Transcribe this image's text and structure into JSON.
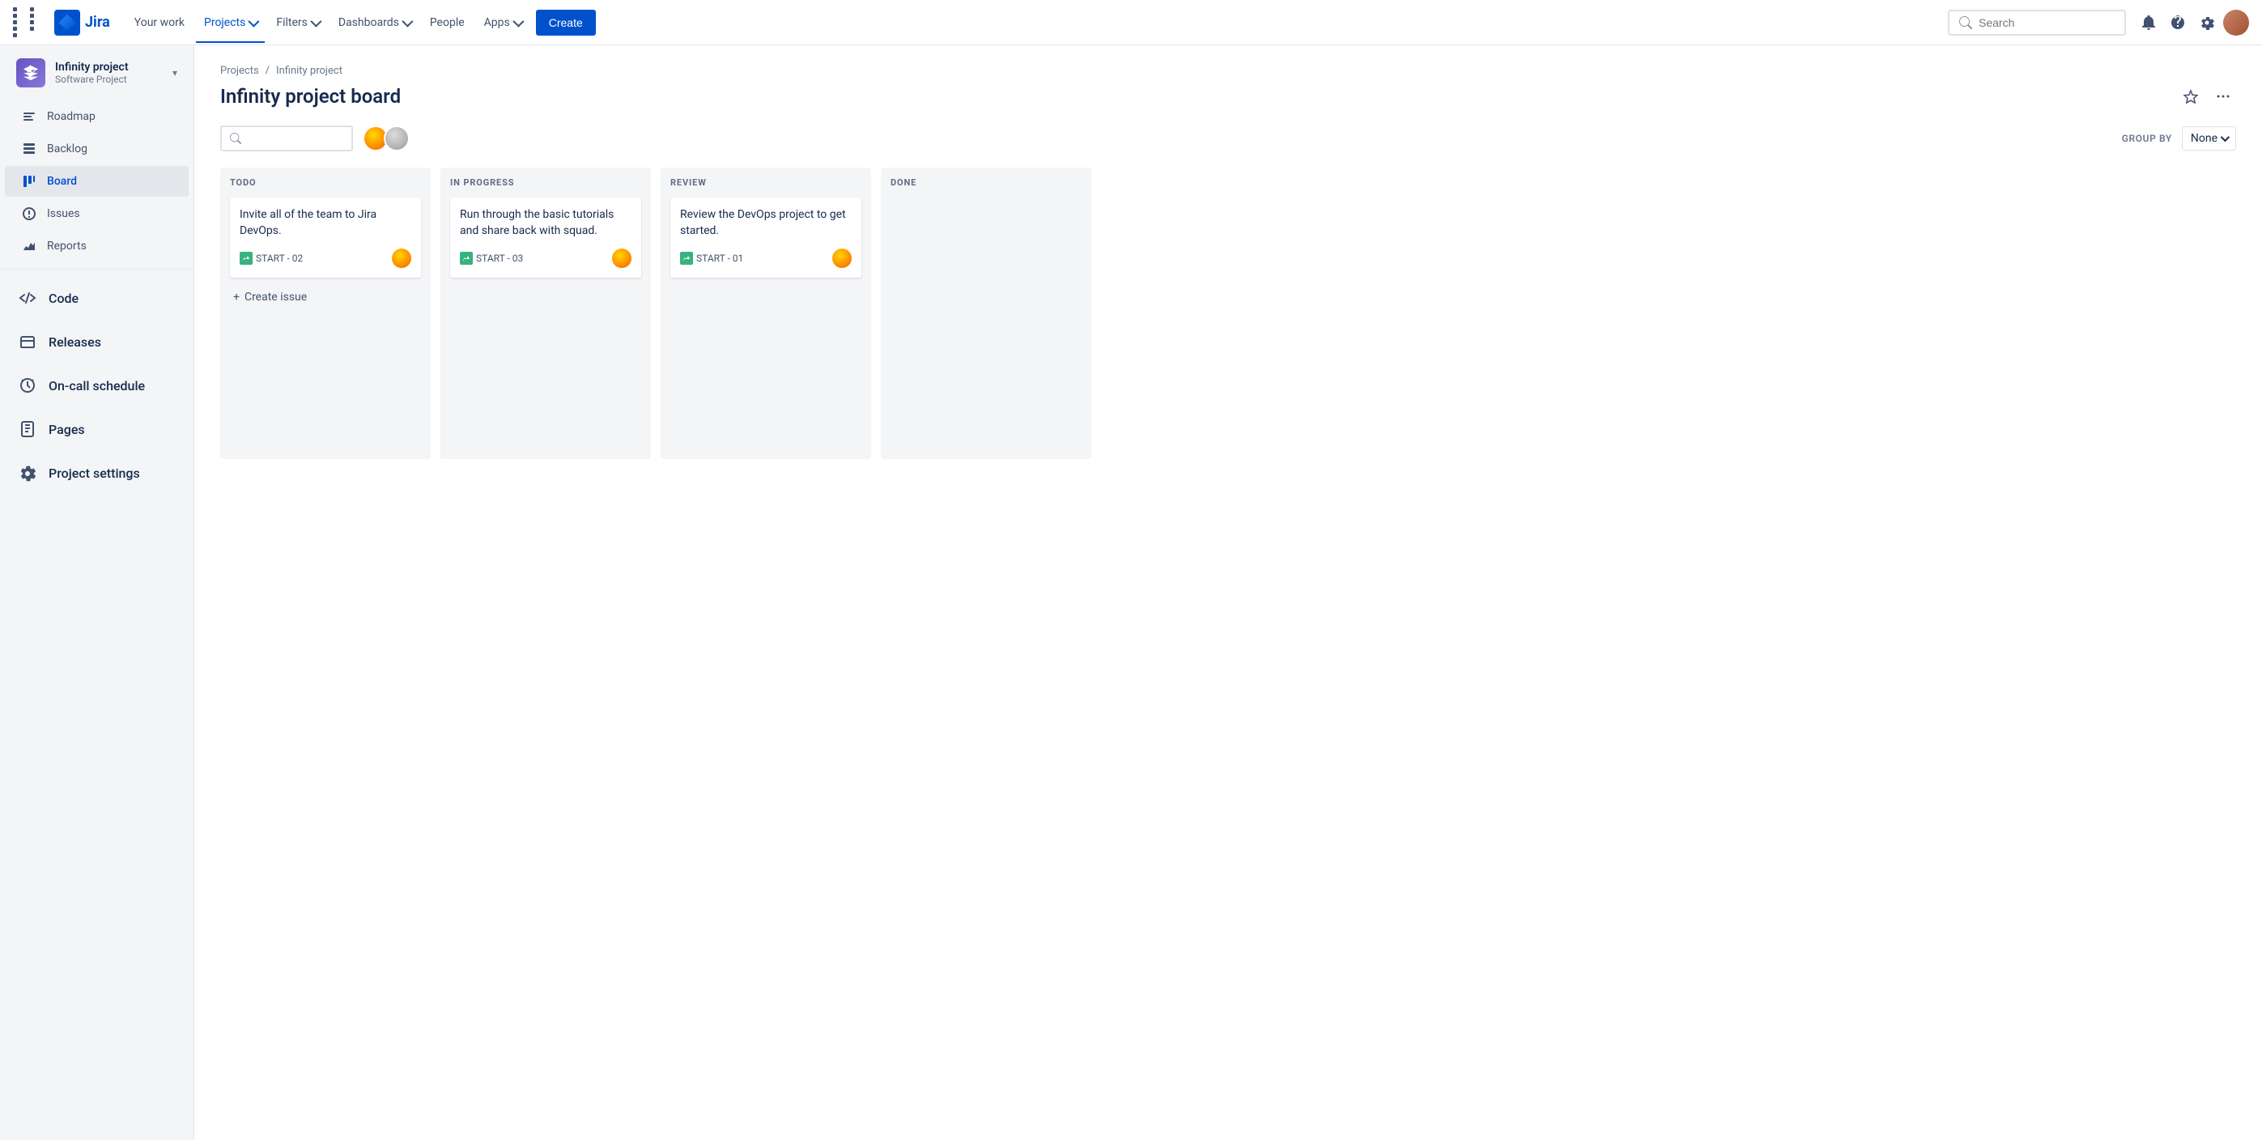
{
  "topnav": {
    "logo_text": "Jira",
    "links": [
      {
        "label": "Your work",
        "active": false
      },
      {
        "label": "Projects",
        "active": true,
        "has_dropdown": true
      },
      {
        "label": "Filters",
        "active": false,
        "has_dropdown": true
      },
      {
        "label": "Dashboards",
        "active": false,
        "has_dropdown": true
      },
      {
        "label": "People",
        "active": false
      },
      {
        "label": "Apps",
        "active": false,
        "has_dropdown": true
      }
    ],
    "create_label": "Create",
    "search_placeholder": "Search"
  },
  "sidebar": {
    "project_name": "Infinity project",
    "project_type": "Software Project",
    "nav_items": [
      {
        "label": "Roadmap",
        "icon": "roadmap"
      },
      {
        "label": "Backlog",
        "icon": "backlog"
      },
      {
        "label": "Board",
        "icon": "board",
        "active": true
      },
      {
        "label": "Issues",
        "icon": "issues"
      },
      {
        "label": "Reports",
        "icon": "reports"
      }
    ],
    "section_items": [
      {
        "label": "Code",
        "icon": "code"
      },
      {
        "label": "Releases",
        "icon": "releases"
      },
      {
        "label": "On-call schedule",
        "icon": "oncall"
      },
      {
        "label": "Pages",
        "icon": "pages"
      },
      {
        "label": "Project settings",
        "icon": "settings"
      }
    ]
  },
  "breadcrumb": {
    "items": [
      "Projects",
      "Infinity project"
    ]
  },
  "page": {
    "title": "Infinity project board"
  },
  "board_toolbar": {
    "search_placeholder": "",
    "group_by_label": "GROUP BY",
    "group_by_value": "None"
  },
  "columns": [
    {
      "id": "todo",
      "header": "TODO",
      "cards": [
        {
          "title": "Invite all of the team to Jira DevOps.",
          "tag": "START - 02",
          "avatar": "orange"
        }
      ],
      "create_label": "Create issue"
    },
    {
      "id": "in_progress",
      "header": "IN PROGRESS",
      "cards": [
        {
          "title": "Run through the basic tutorials and share back with squad.",
          "tag": "START - 03",
          "avatar": "orange"
        }
      ]
    },
    {
      "id": "review",
      "header": "REVIEW",
      "cards": [
        {
          "title": "Review the DevOps project to get started.",
          "tag": "START - 01",
          "avatar": "orange"
        }
      ]
    },
    {
      "id": "done",
      "header": "DONE",
      "cards": []
    }
  ]
}
